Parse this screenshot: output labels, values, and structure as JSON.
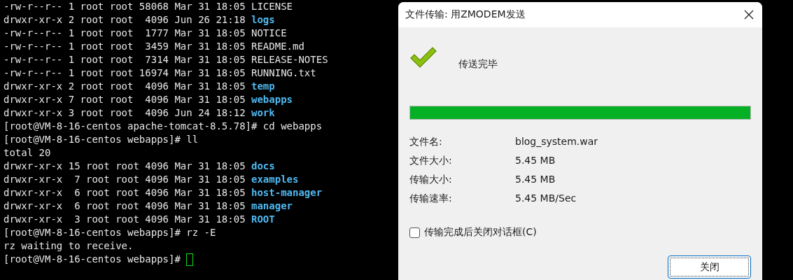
{
  "terminal": {
    "lines": [
      {
        "kind": "entry",
        "text": "-rw-r--r-- 1 root root 58068 Mar 31 18:05 ",
        "name": "LICENSE",
        "is_dir": false
      },
      {
        "kind": "entry",
        "text": "drwxr-xr-x 2 root root  4096 Jun 26 21:18 ",
        "name": "logs",
        "is_dir": true
      },
      {
        "kind": "entry",
        "text": "-rw-r--r-- 1 root root  1777 Mar 31 18:05 ",
        "name": "NOTICE",
        "is_dir": false
      },
      {
        "kind": "entry",
        "text": "-rw-r--r-- 1 root root  3459 Mar 31 18:05 ",
        "name": "README.md",
        "is_dir": false
      },
      {
        "kind": "entry",
        "text": "-rw-r--r-- 1 root root  7314 Mar 31 18:05 ",
        "name": "RELEASE-NOTES",
        "is_dir": false
      },
      {
        "kind": "entry",
        "text": "-rw-r--r-- 1 root root 16974 Mar 31 18:05 ",
        "name": "RUNNING.txt",
        "is_dir": false
      },
      {
        "kind": "entry",
        "text": "drwxr-xr-x 2 root root  4096 Mar 31 18:05 ",
        "name": "temp",
        "is_dir": true
      },
      {
        "kind": "entry",
        "text": "drwxr-xr-x 7 root root  4096 Mar 31 18:05 ",
        "name": "webapps",
        "is_dir": true
      },
      {
        "kind": "entry",
        "text": "drwxr-xr-x 3 root root  4096 Jun 24 18:12 ",
        "name": "work",
        "is_dir": true
      },
      {
        "kind": "plain",
        "text": "[root@VM-8-16-centos apache-tomcat-8.5.78]# cd webapps"
      },
      {
        "kind": "plain",
        "text": "[root@VM-8-16-centos webapps]# ll"
      },
      {
        "kind": "plain",
        "text": "total 20"
      },
      {
        "kind": "entry",
        "text": "drwxr-xr-x 15 root root 4096 Mar 31 18:05 ",
        "name": "docs",
        "is_dir": true
      },
      {
        "kind": "entry",
        "text": "drwxr-xr-x  7 root root 4096 Mar 31 18:05 ",
        "name": "examples",
        "is_dir": true
      },
      {
        "kind": "entry",
        "text": "drwxr-xr-x  6 root root 4096 Mar 31 18:05 ",
        "name": "host-manager",
        "is_dir": true
      },
      {
        "kind": "entry",
        "text": "drwxr-xr-x  6 root root 4096 Mar 31 18:05 ",
        "name": "manager",
        "is_dir": true
      },
      {
        "kind": "entry",
        "text": "drwxr-xr-x  3 root root 4096 Mar 31 18:05 ",
        "name": "ROOT",
        "is_dir": true
      },
      {
        "kind": "plain",
        "text": "[root@VM-8-16-centos webapps]# rz -E"
      },
      {
        "kind": "plain",
        "text": "rz waiting to receive."
      },
      {
        "kind": "prompt",
        "text": "[root@VM-8-16-centos webapps]# "
      }
    ]
  },
  "dialog": {
    "title": "文件传输: 用ZMODEM发送",
    "status": "传送完毕",
    "progress": {
      "level": 1
    },
    "info": [
      {
        "label": "文件名:",
        "value": "blog_system.war"
      },
      {
        "label": "文件大小:",
        "value": "5.45 MB"
      },
      {
        "label": "传输大小:",
        "value": "5.45 MB"
      },
      {
        "label": "传输速率:",
        "value": "5.45 MB/Sec"
      }
    ],
    "close_checkbox": {
      "label": "传输完成后关闭对话框(C)",
      "checked": false
    },
    "button": "关闭"
  }
}
